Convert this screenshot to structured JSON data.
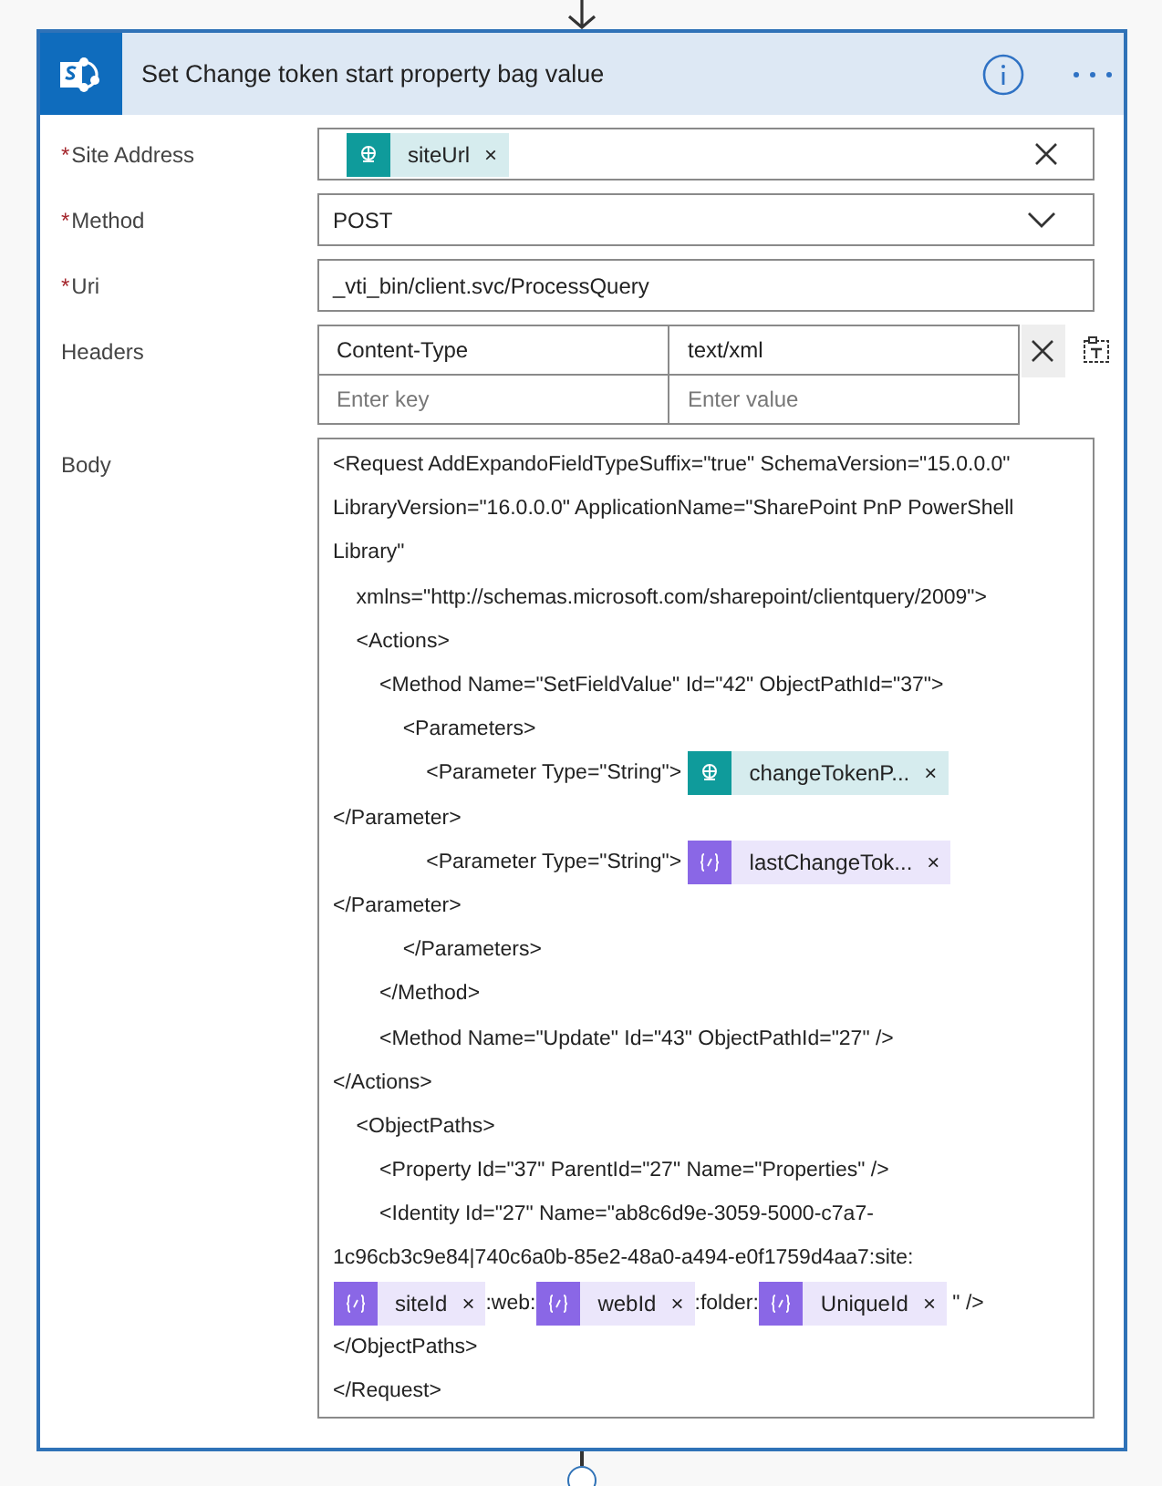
{
  "card": {
    "title": "Set Change token start property bag value",
    "fields": [
      {
        "kind": "tokens",
        "label": "Site Address",
        "required_mark": "*",
        "tokens": [
          {
            "kind": "dynamic",
            "text": "siteUrl",
            "remove": "×"
          }
        ]
      },
      {
        "kind": "dropdown",
        "label": "Method",
        "required_mark": "*",
        "value": "POST"
      },
      {
        "kind": "text",
        "label": "Uri",
        "required_mark": "*",
        "value": "_vti_bin/client.svc/ProcessQuery"
      },
      {
        "kind": "headers",
        "label": "Headers",
        "rows": [
          {
            "key": "Content-Type",
            "value": "text/xml"
          }
        ],
        "key_placeholder": "Enter key",
        "value_placeholder": "Enter value"
      },
      {
        "kind": "body",
        "label": "Body",
        "lines": [
          [
            {
              "text": "<Request AddExpandoFieldTypeSuffix=\"true\" SchemaVersion=\"15.0.0.0\""
            }
          ],
          [
            {
              "text": "LibraryVersion=\"16.0.0.0\" ApplicationName=\"SharePoint PnP PowerShell"
            }
          ],
          [
            {
              "text": "Library\""
            }
          ],
          [
            {
              "text": "    xmlns=\"http://schemas.microsoft.com/sharepoint/clientquery/2009\">"
            }
          ],
          [
            {
              "text": "    <Actions>"
            }
          ],
          [
            {
              "text": "        <Method Name=\"SetFieldValue\" Id=\"42\" ObjectPathId=\"37\">"
            }
          ],
          [
            {
              "text": "            <Parameters>"
            }
          ],
          [
            {
              "text": "                <Parameter Type=\"String\"> "
            },
            {
              "kind": "dynamic",
              "text": "changeTokenP...",
              "remove": "×"
            }
          ],
          [
            {
              "text": "</Parameter>"
            }
          ],
          [
            {
              "text": "                <Parameter Type=\"String\"> "
            },
            {
              "kind": "expression",
              "text": "lastChangeTok...",
              "remove": "×"
            }
          ],
          [
            {
              "text": "</Parameter>"
            }
          ],
          [
            {
              "text": "            </Parameters>"
            }
          ],
          [
            {
              "text": "        </Method>"
            }
          ],
          [
            {
              "text": "        <Method Name=\"Update\" Id=\"43\" ObjectPathId=\"27\" />"
            }
          ],
          [
            {
              "text": "</Actions>"
            }
          ],
          [
            {
              "text": "    <ObjectPaths>"
            }
          ],
          [
            {
              "text": "        <Property Id=\"37\" ParentId=\"27\" Name=\"Properties\" />"
            }
          ],
          [
            {
              "text": "        <Identity Id=\"27\" Name=\"ab8c6d9e-3059-5000-c7a7-"
            }
          ],
          [
            {
              "text": "1c96cb3c9e84|740c6a0b-85e2-48a0-a494-e0f1759d4aa7:site:"
            }
          ],
          [
            {
              "kind": "expression",
              "text": "siteId",
              "remove": "×"
            },
            {
              "text": ":web:"
            },
            {
              "kind": "expression",
              "text": "webId",
              "remove": "×"
            },
            {
              "text": ":folder:"
            },
            {
              "kind": "expression",
              "text": "UniqueId",
              "remove": "×"
            },
            {
              "text": " \" />"
            }
          ],
          [
            {
              "text": "</ObjectPaths>"
            }
          ],
          [
            {
              "text": "</Request>"
            }
          ]
        ]
      }
    ]
  }
}
